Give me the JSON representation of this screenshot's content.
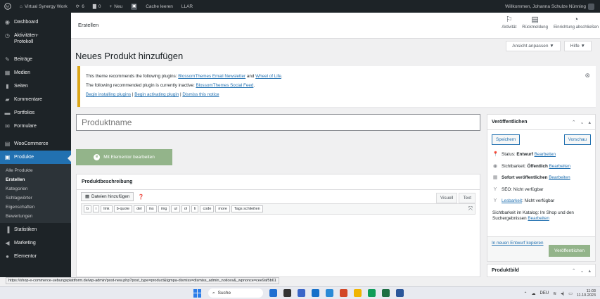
{
  "adminbar": {
    "site_name": "Virtual Synergy Work",
    "updates_count": "6",
    "comments_count": "0",
    "new_label": "Neu",
    "cache_label": "Cache leeren",
    "llar_label": "LLAR",
    "greeting": "Willkommen, Johanna Schulze Nünning"
  },
  "sidebar": {
    "items": [
      {
        "label": "Dashboard",
        "icon": "dashboard-icon"
      },
      {
        "label": "Aktivitäten-Protokoll",
        "icon": "activity-log-icon"
      },
      {
        "label": "Beiträge",
        "icon": "pin-icon"
      },
      {
        "label": "Medien",
        "icon": "media-icon"
      },
      {
        "label": "Seiten",
        "icon": "pages-icon"
      },
      {
        "label": "Kommentare",
        "icon": "comments-icon"
      },
      {
        "label": "Portfolios",
        "icon": "portfolio-icon"
      },
      {
        "label": "Formulare",
        "icon": "forms-icon"
      },
      {
        "label": "WooCommerce",
        "icon": "woocommerce-icon"
      },
      {
        "label": "Produkte",
        "icon": "products-icon"
      }
    ],
    "submenu": [
      "Alle Produkte",
      "Erstellen",
      "Kategorien",
      "Schlagwörter",
      "Eigenschaften",
      "Bewertungen"
    ],
    "submenu_current": "Erstellen",
    "after": [
      {
        "label": "Statistiken",
        "icon": "stats-icon"
      },
      {
        "label": "Marketing",
        "icon": "marketing-icon"
      },
      {
        "label": "Elementor",
        "icon": "elementor-icon"
      }
    ]
  },
  "topbar": {
    "title": "Erstellen",
    "tools": [
      {
        "label": "Aktivität",
        "icon": "flag-icon"
      },
      {
        "label": "Rückmeldung",
        "icon": "feedback-icon"
      },
      {
        "label": "Einrichtung abschließen",
        "icon": "progress-icon"
      }
    ]
  },
  "screen_options": {
    "label": "Ansicht anpassen ▼",
    "help": "Hilfe ▼"
  },
  "page_title": "Neues Produkt hinzufügen",
  "notice": {
    "line1_prefix": "This theme recommends the following plugins: ",
    "line1_link1": "BlossomThemes Email Newsletter",
    "line1_and": " and ",
    "line1_link2": "Wheel of Life",
    "line1_end": ".",
    "line2_prefix": "The following recommended plugin is currently inactive: ",
    "line2_link": "BlossomThemes Social Feed",
    "line2_end": ".",
    "link_install": "Begin installing plugins",
    "link_activate": "Begin activating plugin",
    "link_dismiss": "Dismiss this notice",
    "separator": " | "
  },
  "title_input": {
    "placeholder": "Produktname",
    "value": ""
  },
  "elementor_button": {
    "label": "Mit Elementor bearbeiten"
  },
  "description": {
    "title": "Produktbeschreibung",
    "add_media": "Dateien hinzufügen",
    "tabs": [
      "Visuell",
      "Text"
    ],
    "toolbar": [
      "b",
      "i",
      "link",
      "b-quote",
      "del",
      "ins",
      "img",
      "ul",
      "ol",
      "li",
      "code",
      "more",
      "Tags schließen"
    ]
  },
  "publish": {
    "title": "Veröffentlichen",
    "save": "Speichern",
    "preview": "Vorschau",
    "status_label": "Status:",
    "status_value": "Entwurf",
    "visibility_label": "Sichtbarkeit:",
    "visibility_value": "Öffentlich",
    "publish_now": "Sofort veröffentlichen",
    "seo": "SEO: Nicht verfügbar",
    "readability_link": "Lesbarkeit",
    "readability_rest": ": Nicht verfügbar",
    "catalog": "Sichtbarkeit im Katalog: Im Shop und den Suchergebnissen",
    "edit": "Bearbeiten",
    "copy_draft": "In neuen Entwurf kopieren",
    "publish_button": "Veröffentlichen"
  },
  "image_box": {
    "title": "Produktbild"
  },
  "status_url": "https://shop-e-commerce-uebungsplattform.de/wp-admin/post-new.php?post_type=product&tgmpa-dismiss=dismiss_admin_notices&_wpnonce=cee9af5b61",
  "taskbar": {
    "search": "Suche",
    "lang": "DEU",
    "time": "11:03",
    "date": "11.10.2023"
  },
  "colors": {
    "accent": "#2271b1",
    "adminbar": "#1d2327",
    "elementor": "#93b48a",
    "notice_border": "#dba617"
  }
}
